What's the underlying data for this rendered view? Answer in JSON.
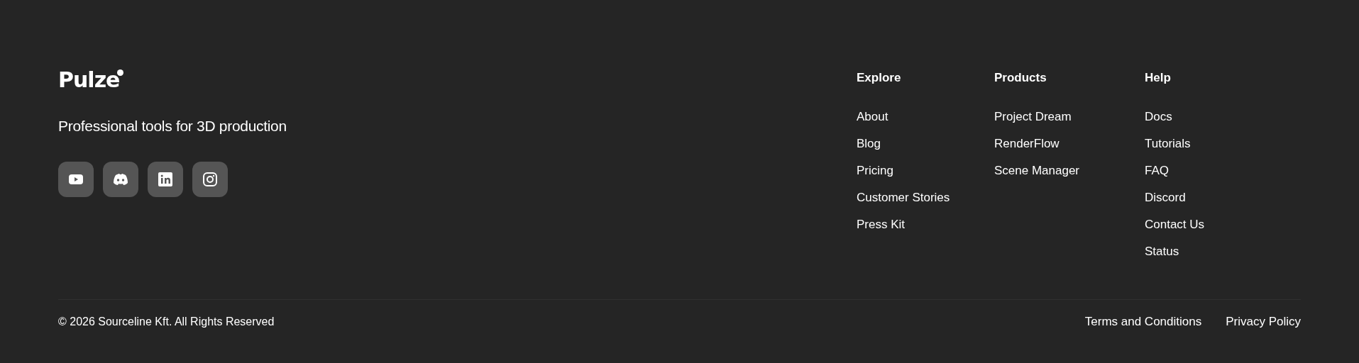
{
  "brand": {
    "logo": "Pulze",
    "tagline": "Professional tools for 3D production"
  },
  "social": [
    {
      "kind": "youtube"
    },
    {
      "kind": "discord"
    },
    {
      "kind": "linkedin"
    },
    {
      "kind": "instagram"
    }
  ],
  "columns": [
    {
      "title": "Explore",
      "links": [
        "About",
        "Blog",
        "Pricing",
        "Customer Stories",
        "Press Kit"
      ]
    },
    {
      "title": "Products",
      "links": [
        "Project Dream",
        "RenderFlow",
        "Scene Manager"
      ]
    },
    {
      "title": "Help",
      "links": [
        "Docs",
        "Tutorials",
        "FAQ",
        "Discord",
        "Contact Us",
        "Status"
      ]
    }
  ],
  "copyright": "© 2026 Sourceline Kft. All Rights Reserved",
  "legal_links": [
    "Terms and Conditions",
    "Privacy Policy"
  ]
}
